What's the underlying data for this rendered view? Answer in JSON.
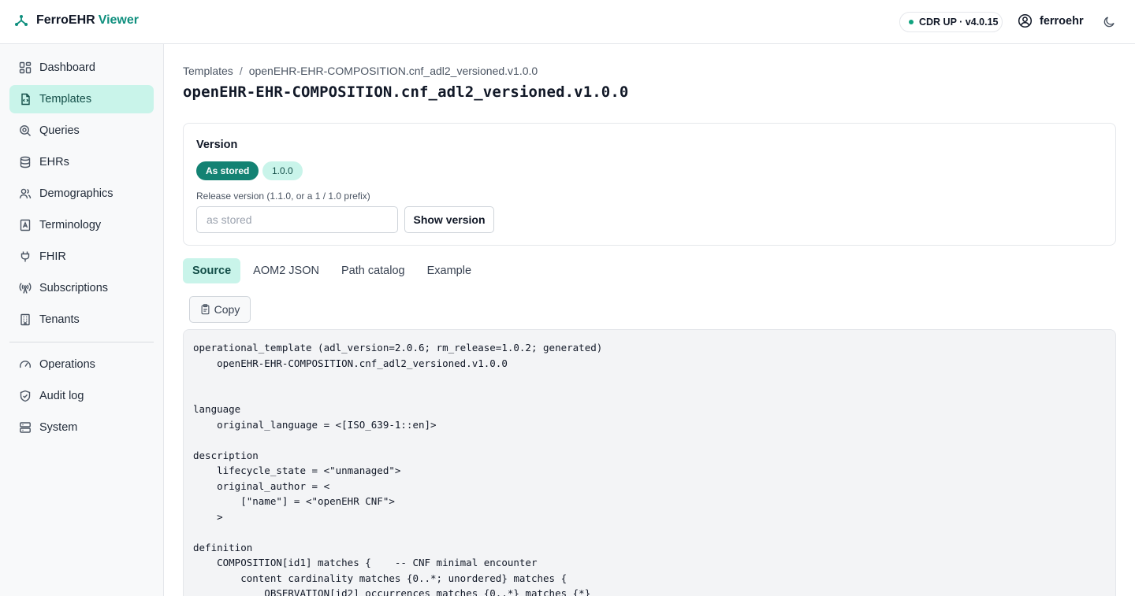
{
  "header": {
    "brand_name": "FerroEHR",
    "brand_accent": "Viewer",
    "status": "CDR UP · v4.0.15",
    "username": "ferroehr"
  },
  "sidebar": {
    "items": [
      {
        "label": "Dashboard",
        "icon": "dashboard-icon"
      },
      {
        "label": "Templates",
        "icon": "template-file-icon",
        "active": true
      },
      {
        "label": "Queries",
        "icon": "search-icon"
      },
      {
        "label": "EHRs",
        "icon": "database-icon"
      },
      {
        "label": "Demographics",
        "icon": "users-icon"
      },
      {
        "label": "Terminology",
        "icon": "book-icon"
      },
      {
        "label": "FHIR",
        "icon": "plug-icon"
      },
      {
        "label": "Subscriptions",
        "icon": "broadcast-icon"
      },
      {
        "label": "Tenants",
        "icon": "building-icon"
      },
      {
        "label": "Operations",
        "icon": "gauge-icon"
      },
      {
        "label": "Audit log",
        "icon": "shield-icon"
      },
      {
        "label": "System",
        "icon": "server-icon"
      }
    ]
  },
  "breadcrumb": {
    "root": "Templates",
    "separator": "/",
    "current": "openEHR-EHR-COMPOSITION.cnf_adl2_versioned.v1.0.0"
  },
  "page_title": "openEHR-EHR-COMPOSITION.cnf_adl2_versioned.v1.0.0",
  "version_card": {
    "title": "Version",
    "chip_primary": "As stored",
    "chip_secondary": "1.0.0",
    "field_label": "Release version (1.1.0, or a 1 / 1.0 prefix)",
    "input_placeholder": "as stored",
    "input_value": "",
    "button_label": "Show version"
  },
  "tabs": [
    {
      "label": "Source",
      "active": true
    },
    {
      "label": "AOM2 JSON"
    },
    {
      "label": "Path catalog"
    },
    {
      "label": "Example"
    }
  ],
  "copy_label": "Copy",
  "code": "operational_template (adl_version=2.0.6; rm_release=1.0.2; generated)\n    openEHR-EHR-COMPOSITION.cnf_adl2_versioned.v1.0.0\n\n\nlanguage\n    original_language = <[ISO_639-1::en]>\n\ndescription\n    lifecycle_state = <\"unmanaged\">\n    original_author = <\n        [\"name\"] = <\"openEHR CNF\">\n    >\n\ndefinition\n    COMPOSITION[id1] matches {    -- CNF minimal encounter\n        content cardinality matches {0..*; unordered} matches {\n            OBSERVATION[id2] occurrences matches {0..*} matches {*}",
  "colors": {
    "accent": "#0f8f7e",
    "active_bg": "#c9f4ea",
    "chip_primary_bg": "#138273",
    "status_dot": "#10a37f"
  }
}
